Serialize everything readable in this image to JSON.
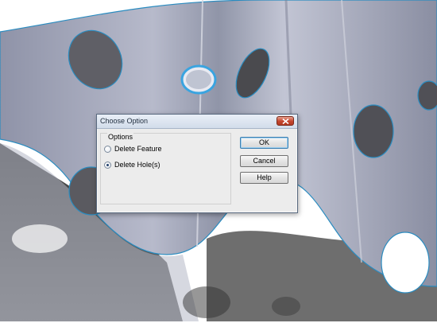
{
  "dialog": {
    "title": "Choose Option",
    "options_group": {
      "legend": "Options",
      "radios": [
        {
          "label": "Delete Feature",
          "checked": false
        },
        {
          "label": "Delete Hole(s)",
          "checked": true
        }
      ]
    },
    "buttons": {
      "ok": "OK",
      "cancel": "Cancel",
      "help": "Help"
    }
  },
  "colors": {
    "surface": "#9aa0b4",
    "outline": "#2a8cc0",
    "shadow": "#4a4a4a",
    "title_accent": "#c4442c"
  },
  "icons": {
    "close": "close-icon"
  }
}
